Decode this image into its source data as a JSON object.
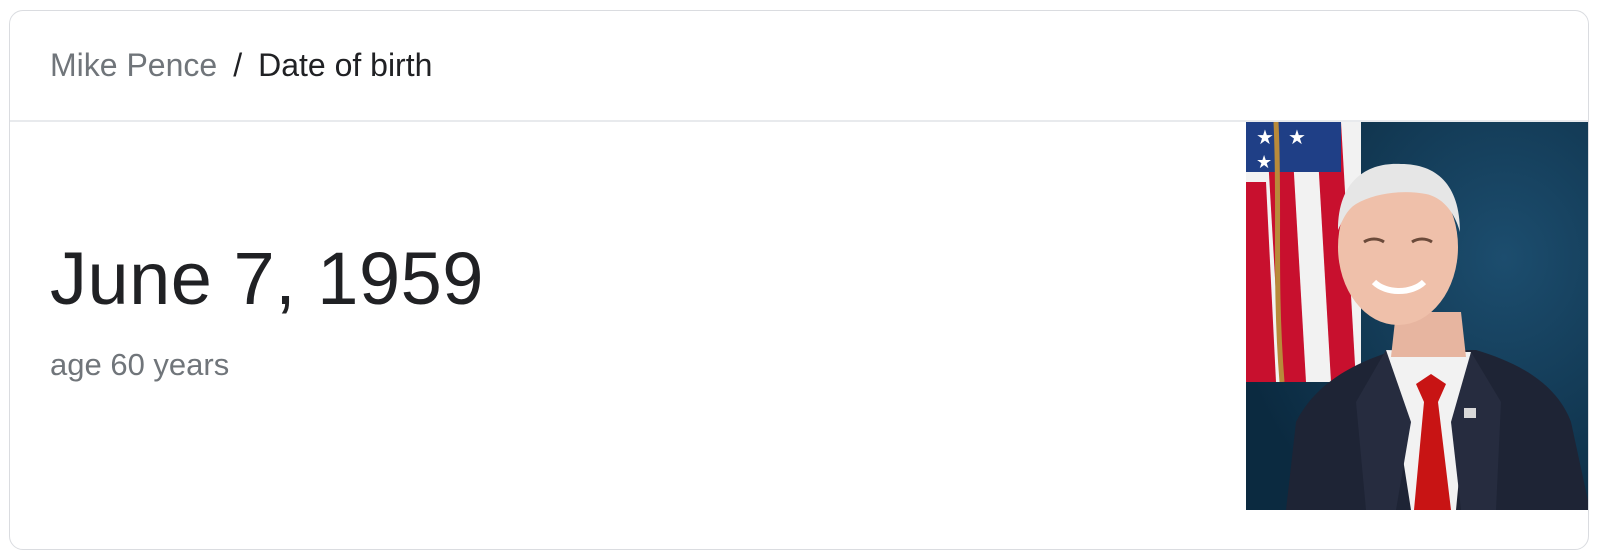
{
  "breadcrumb": {
    "parent": "Mike Pence",
    "separator": "/",
    "current": "Date of birth"
  },
  "answer": {
    "date": "June 7, 1959",
    "age": "age 60 years"
  },
  "colors": {
    "primary_text": "#202124",
    "secondary_text": "#70757a",
    "border": "#dadce0",
    "photo_background": "#0f3550",
    "flag_red": "#c8102e",
    "tie_red": "#c81414",
    "suit": "#1e2435"
  },
  "image": {
    "icon": "portrait-photo"
  }
}
